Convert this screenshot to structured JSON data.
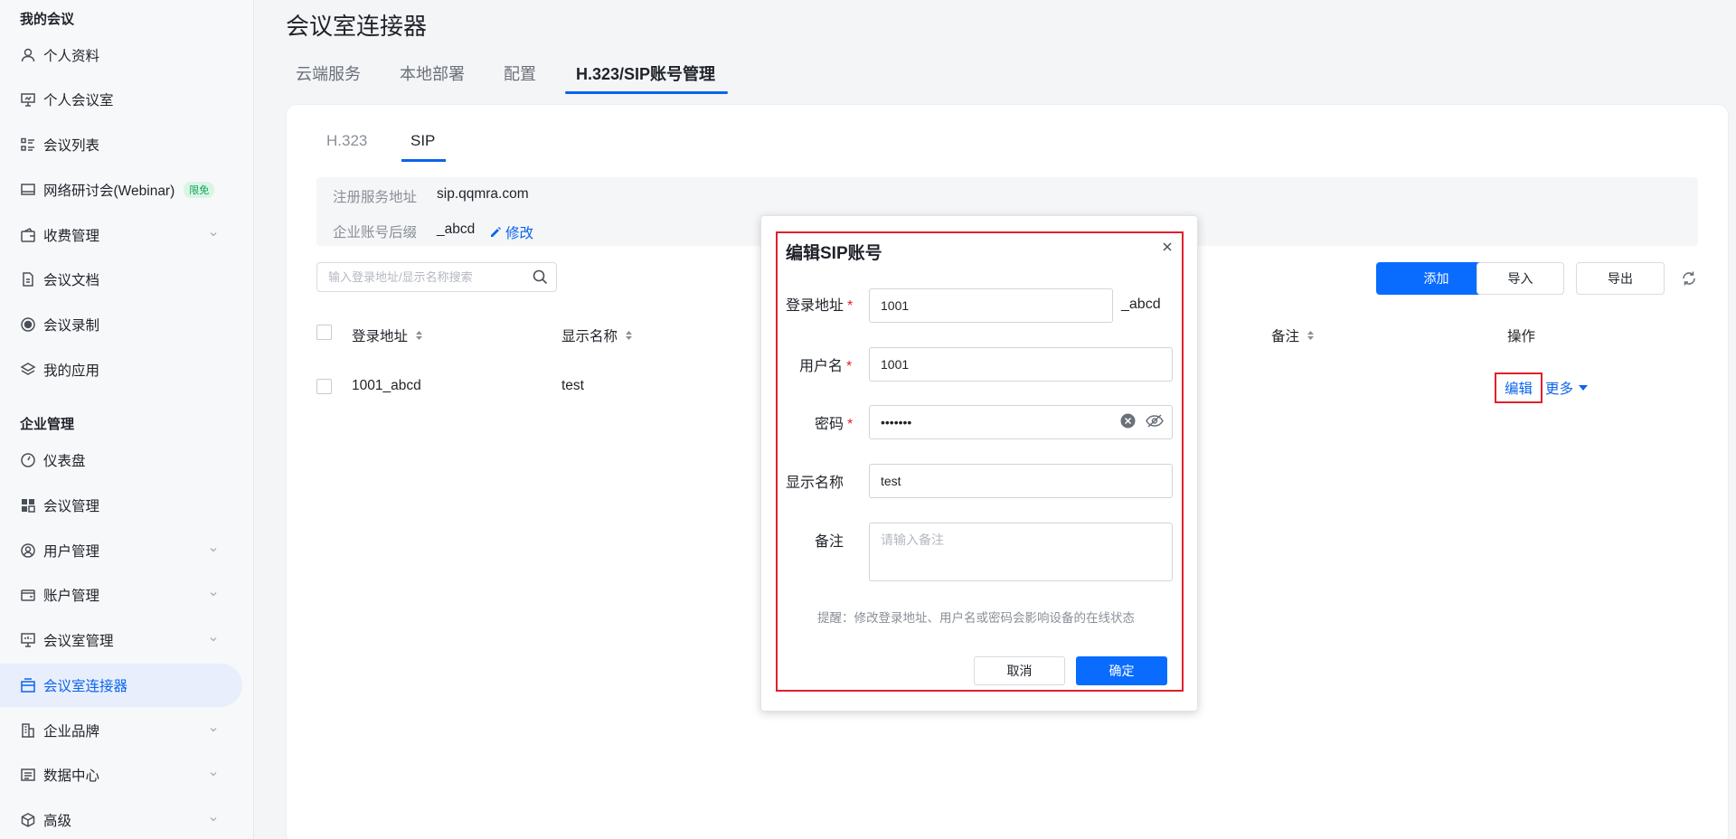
{
  "sidebar": {
    "section_my_meetings": "我的会议",
    "section_enterprise": "企业管理",
    "items": [
      {
        "label": "个人资料",
        "icon": "user-icon"
      },
      {
        "label": "个人会议室",
        "icon": "presentation-icon"
      },
      {
        "label": "会议列表",
        "icon": "list-icon"
      },
      {
        "label": "网络研讨会(Webinar)",
        "icon": "monitor-icon",
        "badge": "限免"
      },
      {
        "label": "收费管理",
        "icon": "wallet-icon"
      },
      {
        "label": "会议文档",
        "icon": "document-icon"
      },
      {
        "label": "会议录制",
        "icon": "record-icon"
      },
      {
        "label": "我的应用",
        "icon": "layers-icon"
      },
      {
        "label": "仪表盘",
        "icon": "dashboard-icon"
      },
      {
        "label": "会议管理",
        "icon": "grid-icon"
      },
      {
        "label": "用户管理",
        "icon": "user-circle-icon"
      },
      {
        "label": "账户管理",
        "icon": "account-icon"
      },
      {
        "label": "会议室管理",
        "icon": "room-icon"
      },
      {
        "label": "会议室连接器",
        "icon": "connector-icon"
      },
      {
        "label": "企业品牌",
        "icon": "building-icon"
      },
      {
        "label": "数据中心",
        "icon": "data-icon"
      },
      {
        "label": "高级",
        "icon": "cube-icon"
      }
    ]
  },
  "main": {
    "title": "会议室连接器",
    "tabs": [
      "云端服务",
      "本地部署",
      "配置",
      "H.323/SIP账号管理"
    ],
    "sub_tabs": [
      "H.323",
      "SIP"
    ],
    "info": {
      "server_label": "注册服务地址",
      "server_value": "sip.qqmra.com",
      "suffix_label": "企业账号后缀",
      "suffix_value": "_abcd",
      "modify_label": "修改"
    },
    "search_placeholder": "输入登录地址/显示名称搜索",
    "buttons": {
      "add": "添加",
      "import": "导入",
      "export": "导出"
    },
    "table": {
      "headers": [
        "登录地址",
        "显示名称",
        "备注",
        "操作"
      ],
      "rows": [
        {
          "login": "1001_abcd",
          "display": "test",
          "edit": "编辑",
          "more": "更多"
        }
      ]
    }
  },
  "dialog": {
    "title": "编辑SIP账号",
    "login_label": "登录地址",
    "login_value": "1001",
    "login_suffix": "_abcd",
    "username_label": "用户名",
    "username_value": "1001",
    "password_label": "密码",
    "password_value": "•••••••",
    "display_label": "显示名称",
    "display_value": "test",
    "remark_label": "备注",
    "remark_placeholder": "请输入备注",
    "hint": "提醒：修改登录地址、用户名或密码会影响设备的在线状态",
    "cancel": "取消",
    "confirm": "确定"
  },
  "colors": {
    "accent": "#0a64ec",
    "highlight": "#e0212b",
    "active_bg": "#e8eefc"
  }
}
